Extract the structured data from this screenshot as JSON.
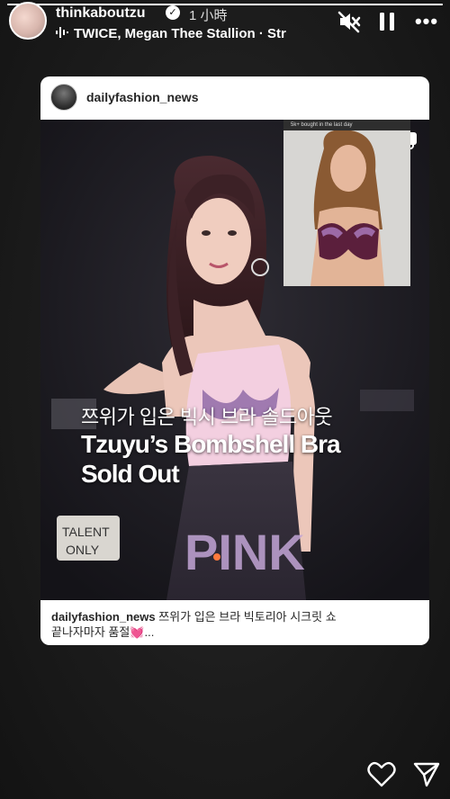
{
  "story": {
    "progress_fraction": 1.0
  },
  "header": {
    "username": "thinkaboutzu",
    "time": "1 小時",
    "music": "TWICE, Megan Thee Stallion · Str",
    "more_label": "•••"
  },
  "post": {
    "username": "dailyfashion_news",
    "inset_banner": "5k+ bought in the last day",
    "overlay_korean": "쯔위가 입은 빅시 브라 솔드아웃",
    "overlay_english_line1": "Tzuyu’s Bombshell Bra",
    "overlay_english_line2": "Sold Out",
    "caption_user": "dailyfashion_news",
    "caption_text": "쯔위가 입은 브라 빅토리아 시크릿 쇼",
    "caption_text_line2": "끝나자마자 품절",
    "caption_emoji": "💓",
    "caption_more": "..."
  },
  "icons": {
    "mute": "speaker-muted-icon",
    "pause": "pause-icon",
    "more": "more-icon",
    "verified": "verified-badge-icon",
    "music": "music-bars-icon",
    "carousel": "carousel-icon",
    "like": "heart-icon",
    "share": "send-icon"
  },
  "colors": {
    "background": "#1c1c1c",
    "card": "#ffffff",
    "text_dark": "#262626",
    "bra_purple": "#5b1f3c"
  }
}
